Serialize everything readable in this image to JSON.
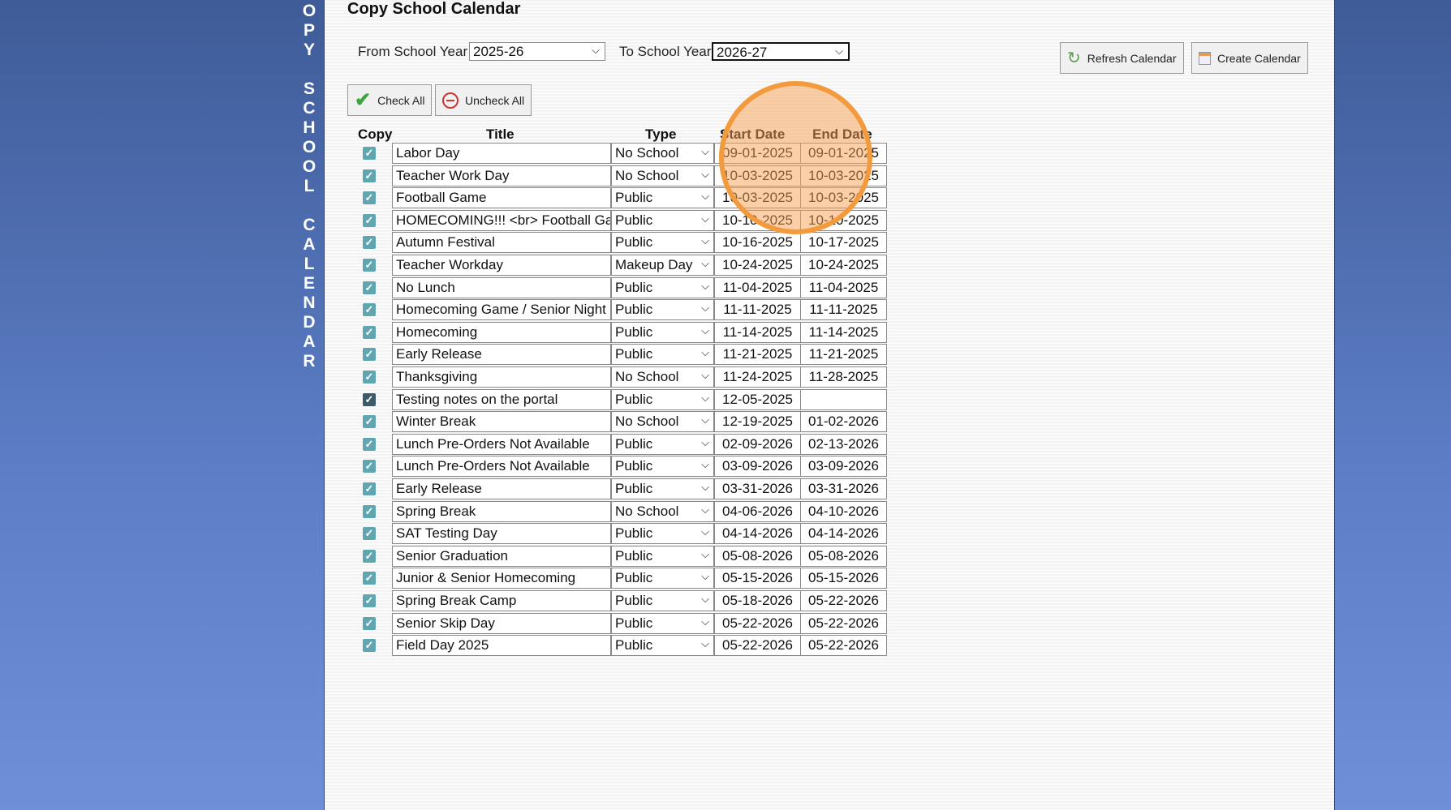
{
  "sidebar": {
    "vertical_title": "O\nP\nY\n\nS\nC\nH\nO\nO\nL\n\nC\nA\nL\nE\nN\nD\nA\nR"
  },
  "page": {
    "title": "Copy School Calendar"
  },
  "filters": {
    "from_label": "From School Year",
    "from_value": "2025-26",
    "to_label": "To School Year",
    "to_value": "2026-27"
  },
  "buttons": {
    "check_all": "Check All",
    "uncheck_all": "Uncheck All",
    "refresh": "Refresh Calendar",
    "create": "Create Calendar"
  },
  "table": {
    "headers": {
      "copy": "Copy",
      "title": "Title",
      "type": "Type",
      "start": "Start Date",
      "end": "End Date"
    },
    "rows": [
      {
        "title": "Labor Day",
        "type": "No School",
        "start": "09-01-2025",
        "end": "09-01-2025"
      },
      {
        "title": "Teacher Work Day",
        "type": "No School",
        "start": "10-03-2025",
        "end": "10-03-2025"
      },
      {
        "title": "Football Game",
        "type": "Public",
        "start": "10-03-2025",
        "end": "10-03-2025"
      },
      {
        "title": "HOMECOMING!!! <br> Football Game",
        "type": "Public",
        "start": "10-10-2025",
        "end": "10-10-2025"
      },
      {
        "title": "Autumn Festival",
        "type": "Public",
        "start": "10-16-2025",
        "end": "10-17-2025"
      },
      {
        "title": "Teacher Workday",
        "type": "Makeup Day",
        "start": "10-24-2025",
        "end": "10-24-2025"
      },
      {
        "title": "No Lunch",
        "type": "Public",
        "start": "11-04-2025",
        "end": "11-04-2025"
      },
      {
        "title": "Homecoming Game / Senior Night",
        "type": "Public",
        "start": "11-11-2025",
        "end": "11-11-2025"
      },
      {
        "title": "Homecoming",
        "type": "Public",
        "start": "11-14-2025",
        "end": "11-14-2025"
      },
      {
        "title": "Early Release",
        "type": "Public",
        "start": "11-21-2025",
        "end": "11-21-2025"
      },
      {
        "title": "Thanksgiving",
        "type": "No School",
        "start": "11-24-2025",
        "end": "11-28-2025"
      },
      {
        "title": "Testing notes on the portal",
        "type": "Public",
        "start": "12-05-2025",
        "end": "",
        "focused": true
      },
      {
        "title": "Winter Break",
        "type": "No School",
        "start": "12-19-2025",
        "end": "01-02-2026"
      },
      {
        "title": "Lunch Pre-Orders Not Available",
        "type": "Public",
        "start": "02-09-2026",
        "end": "02-13-2026"
      },
      {
        "title": "Lunch Pre-Orders Not Available",
        "type": "Public",
        "start": "03-09-2026",
        "end": "03-09-2026"
      },
      {
        "title": "Early Release",
        "type": "Public",
        "start": "03-31-2026",
        "end": "03-31-2026"
      },
      {
        "title": "Spring Break",
        "type": "No School",
        "start": "04-06-2026",
        "end": "04-10-2026"
      },
      {
        "title": "SAT Testing Day",
        "type": "Public",
        "start": "04-14-2026",
        "end": "04-14-2026"
      },
      {
        "title": "Senior Graduation",
        "type": "Public",
        "start": "05-08-2026",
        "end": "05-08-2026"
      },
      {
        "title": "Junior & Senior Homecoming",
        "type": "Public",
        "start": "05-15-2026",
        "end": "05-15-2026"
      },
      {
        "title": "Spring Break Camp",
        "type": "Public",
        "start": "05-18-2026",
        "end": "05-22-2026"
      },
      {
        "title": "Senior Skip Day",
        "type": "Public",
        "start": "05-22-2026",
        "end": "05-22-2026"
      },
      {
        "title": "Field Day 2025",
        "type": "Public",
        "start": "05-22-2026",
        "end": "05-22-2026"
      }
    ]
  },
  "colors": {
    "highlight": "#f39a3c",
    "checkbox": "#5fa6b0"
  }
}
